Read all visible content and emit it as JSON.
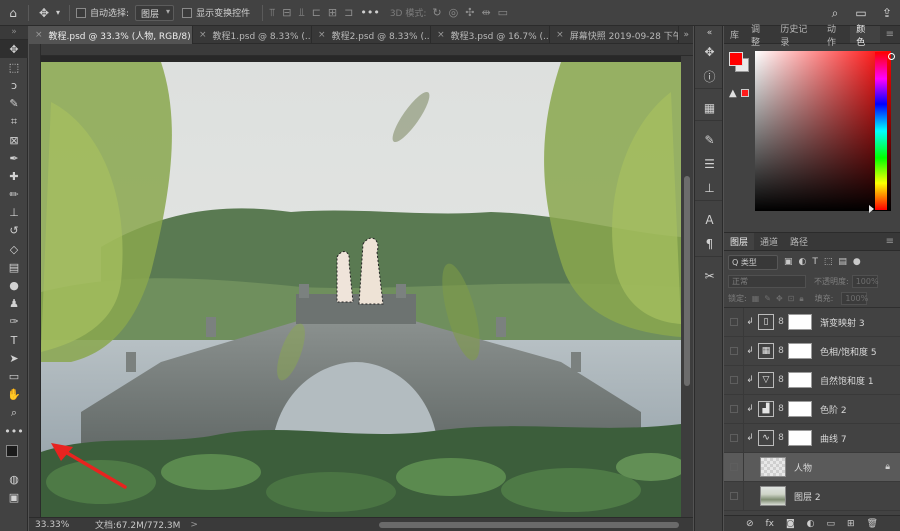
{
  "options_bar": {
    "auto_select_label": "自动选择:",
    "auto_select_value": "图层",
    "show_transform_label": "显示变换控件",
    "mode_3d_label": "3D 模式:"
  },
  "document_tabs": [
    {
      "label": "教程.psd @ 33.3% (人物, RGB/8) *",
      "active": true
    },
    {
      "label": "教程1.psd @ 8.33% (...",
      "active": false
    },
    {
      "label": "教程2.psd @ 8.33% (...",
      "active": false
    },
    {
      "label": "教程3.psd @ 16.7% (...",
      "active": false
    },
    {
      "label": "屏幕快照 2019-09-28 下午",
      "active": false
    }
  ],
  "tabs_more": "»",
  "status_bar": {
    "zoom": "33.33%",
    "doc_info": "文档:67.2M/772.3M",
    "caret": ">"
  },
  "color_panel": {
    "tabs": [
      "库",
      "调整",
      "历史记录",
      "动作",
      "颜色"
    ],
    "active_tab": "颜色",
    "foreground": "#ff0000",
    "background": "#e9e9e9"
  },
  "layers_panel": {
    "tabs": [
      "图层",
      "通道",
      "路径"
    ],
    "active_tab": "图层",
    "kind_filter": "Q 类型",
    "blend_mode": "正常",
    "opacity_label": "不透明度:",
    "opacity_value": "100%",
    "lock_label": "锁定:",
    "fill_label": "填充:",
    "fill_value": "100%",
    "layers": [
      {
        "name": "渐变映射 3",
        "type": "adjustment",
        "icon": "▯",
        "selected": false
      },
      {
        "name": "色相/饱和度 5",
        "type": "adjustment",
        "icon": "▦",
        "selected": false
      },
      {
        "name": "自然饱和度 1",
        "type": "adjustment",
        "icon": "▽",
        "selected": false
      },
      {
        "name": "色阶 2",
        "type": "adjustment",
        "icon": "▟",
        "selected": false
      },
      {
        "name": "曲线 7",
        "type": "adjustment",
        "icon": "∿",
        "selected": false
      },
      {
        "name": "人物",
        "type": "pixel",
        "selected": true,
        "locked": true
      },
      {
        "name": "图层 2",
        "type": "pixel",
        "selected": false
      }
    ]
  },
  "colors": {
    "accent_red": "#ff0000",
    "annotation_arrow": "#e8231f"
  }
}
